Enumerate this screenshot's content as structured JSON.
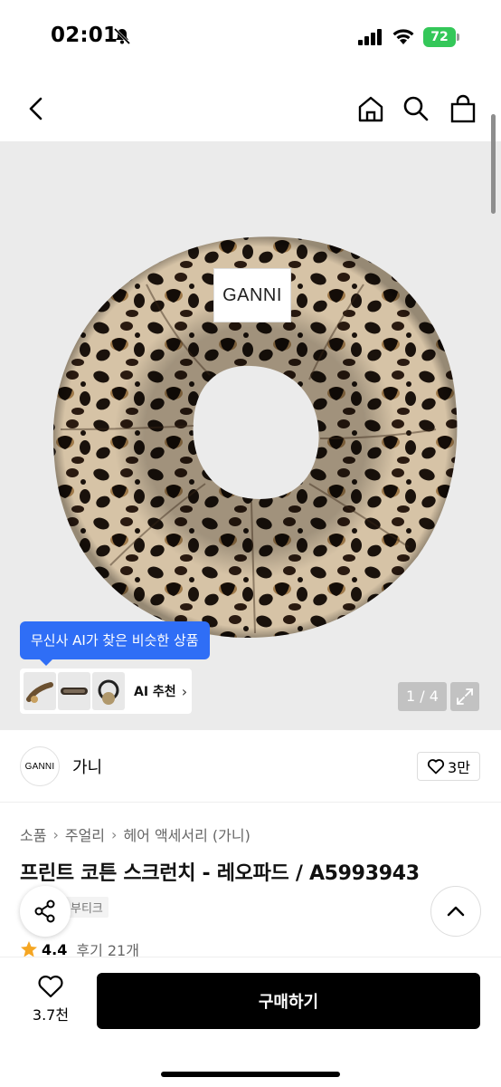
{
  "status_bar": {
    "time": "02:01",
    "battery": "72"
  },
  "nav": {
    "icons": [
      "back-icon",
      "home-icon",
      "search-icon",
      "bag-icon"
    ]
  },
  "product_image": {
    "brand_tag": "GANNI",
    "ai_tooltip": "무신사 AI가 찾은 비슷한 상품",
    "ai_recommend_label": "AI 추천",
    "page_indicator": "1 / 4"
  },
  "brand": {
    "logo_text": "GANNI",
    "name": "가니",
    "like_count": "3만"
  },
  "breadcrumb": [
    "소품",
    "주얼리",
    "헤어 액세서리 (가니)"
  ],
  "product": {
    "title": "프린트 코튼 스크런치 - 레오파드 / A5993943",
    "tag": "부티크",
    "rating": "4.4",
    "reviews": "후기 21개"
  },
  "bottom_bar": {
    "wish_count": "3.7천",
    "buy_label": "구매하기"
  },
  "colors": {
    "accent": "#2f6ef6",
    "battery": "#34c759",
    "star": "#f5a623"
  }
}
